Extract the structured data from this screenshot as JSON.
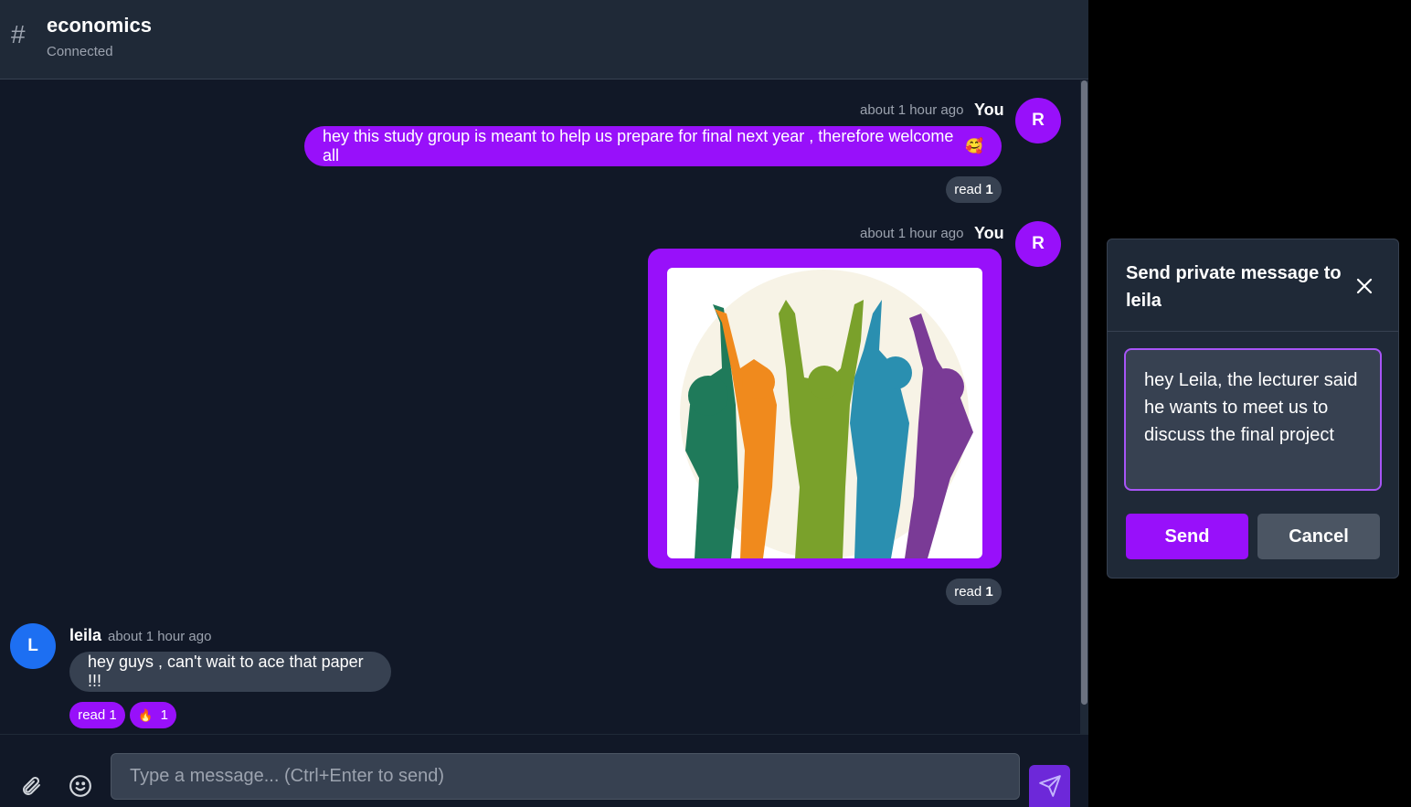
{
  "header": {
    "channel_name": "economics",
    "status": "Connected"
  },
  "messages": [
    {
      "sender": "You",
      "time": "about 1 hour ago",
      "avatar": "R",
      "text": "hey this study group is meant to help us prepare for final next year , therefore welcome all",
      "emoji": "🥰",
      "read_label": "read",
      "read_count": "1"
    },
    {
      "sender": "You",
      "time": "about 1 hour ago",
      "avatar": "R",
      "image_desc": "colorful-silhouettes-image",
      "read_label": "read",
      "read_count": "1"
    },
    {
      "sender": "leila",
      "time": "about 1 hour ago",
      "avatar": "L",
      "text": "hey guys , can't wait to ace that paper !!!",
      "read_label": "read",
      "read_count": "1",
      "reaction_emoji": "🔥",
      "reaction_count": "1"
    }
  ],
  "composer": {
    "placeholder": "Type a message... (Ctrl+Enter to send)"
  },
  "modal": {
    "title": "Send private message to leila",
    "message": "hey Leila, the lecturer said he wants to meet us to discuss the final project",
    "send_label": "Send",
    "cancel_label": "Cancel"
  },
  "colors": {
    "accent": "#9810fa",
    "blue_avatar": "#1d6ff2",
    "panel": "#1f2937",
    "background": "#111827"
  },
  "icons": [
    "hash-icon",
    "paperclip-icon",
    "smiley-icon",
    "send-icon",
    "close-icon"
  ]
}
